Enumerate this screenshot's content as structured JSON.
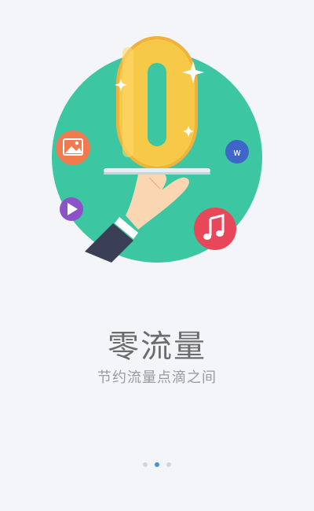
{
  "onboarding": {
    "title": "零流量",
    "subtitle": "节约流量点滴之间",
    "illustration_digit": "0"
  },
  "icons": {
    "image": "image-icon",
    "play": "play-icon",
    "music": "music-note-icon",
    "word": "word-doc-icon",
    "sparkle": "sparkle-icon"
  },
  "pager": {
    "count": 3,
    "active_index": 1
  },
  "colors": {
    "background": "#f3f5f8",
    "circle": "#3cc7a2",
    "digit": "#f6c343",
    "image_badge": "#f07b4e",
    "play_badge": "#8b52c9",
    "music_badge": "#e8475a",
    "word_badge": "#3f65c9",
    "active_dot": "#4a90e2"
  }
}
